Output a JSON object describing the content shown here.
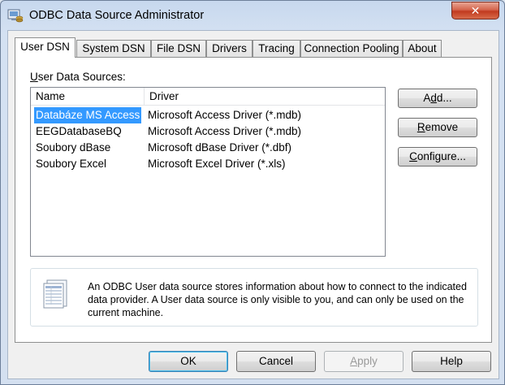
{
  "window": {
    "title": "ODBC Data Source Administrator",
    "close_glyph": "✕"
  },
  "tabs": [
    {
      "label": "User DSN",
      "active": true
    },
    {
      "label": "System DSN"
    },
    {
      "label": "File DSN"
    },
    {
      "label": "Drivers"
    },
    {
      "label": "Tracing"
    },
    {
      "label": "Connection Pooling"
    },
    {
      "label": "About"
    }
  ],
  "user_dsn": {
    "group_label_accel": "U",
    "group_label_rest": "ser Data Sources:",
    "columns": [
      "Name",
      "Driver"
    ],
    "rows": [
      {
        "name": "Databáze MS Access",
        "driver": "Microsoft Access Driver (*.mdb)",
        "selected": true
      },
      {
        "name": "EEGDatabaseBQ",
        "driver": "Microsoft Access Driver (*.mdb)"
      },
      {
        "name": "Soubory dBase",
        "driver": "Microsoft dBase Driver (*.dbf)"
      },
      {
        "name": "Soubory Excel",
        "driver": "Microsoft Excel Driver (*.xls)"
      }
    ],
    "buttons": {
      "add": {
        "pre": "A",
        "accel": "d",
        "post": "d..."
      },
      "remove": {
        "pre": "",
        "accel": "R",
        "post": "emove"
      },
      "configure": {
        "pre": "",
        "accel": "C",
        "post": "onfigure..."
      }
    },
    "info_text": "An ODBC User data source stores information about how to connect to the indicated data provider.  A User data source is only visible to you, and can only be used on the current machine."
  },
  "footer": {
    "ok": "OK",
    "cancel": "Cancel",
    "apply_accel": "A",
    "apply_rest": "pply",
    "help": "Help"
  },
  "icons": {
    "app": "odbc-admin-icon",
    "info": "data-source-document-icon"
  }
}
